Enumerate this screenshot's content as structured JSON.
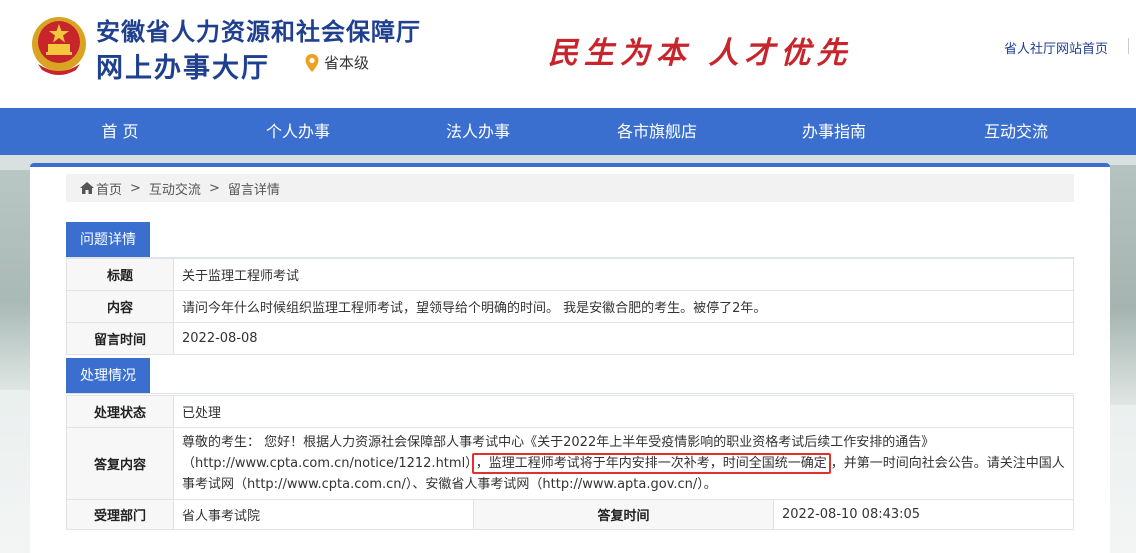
{
  "header": {
    "title": "安徽省人力资源和社会保障厅",
    "subtitle": "网上办事大厅",
    "location": "省本级",
    "slogan": "民生为本 人才优先",
    "home_link": "省人社厅网站首页"
  },
  "nav": {
    "items": [
      "首 页",
      "个人办事",
      "法人办事",
      "各市旗舰店",
      "办事指南",
      "互动交流"
    ]
  },
  "breadcrumb": {
    "home": "首页",
    "level1": "互动交流",
    "level2": "留言详情",
    "sep": ">"
  },
  "question": {
    "section_title": "问题详情",
    "rows": [
      {
        "label": "标题",
        "value": "关于监理工程师考试"
      },
      {
        "label": "内容",
        "value": "请问今年什么时候组织监理工程师考试，望领导给个明确的时间。 我是安徽合肥的考生。被停了2年。"
      },
      {
        "label": "留言时间",
        "value": "2022-08-08"
      }
    ]
  },
  "handling": {
    "section_title": "处理情况",
    "status_label": "处理状态",
    "status_value": "已处理",
    "answer_label": "答复内容",
    "answer_part1": "尊敬的考生：  您好！根据人力资源社会保障部人事考试中心《关于2022年上半年受疫情影响的职业资格考试后续工作安排的通告》（http://www.cpta.com.cn/notice/1212.html）",
    "answer_highlight": "，监理工程师考试将于年内安排一次补考，时间全国统一确定",
    "answer_part2": "，并第一时间向社会公告。请关注中国人事考试网（http://www.cpta.com.cn/）、安徽省人事考试网（http://www.apta.gov.cn/）。",
    "dept_label": "受理部门",
    "dept_value": "省人事考试院",
    "reply_time_label": "答复时间",
    "reply_time_value": "2022-08-10 08:43:05"
  },
  "colors": {
    "brand_blue": "#3b6fcf",
    "title_blue": "#1f3f8f",
    "slogan_red": "#c8242b",
    "highlight_red": "#e0312a"
  }
}
